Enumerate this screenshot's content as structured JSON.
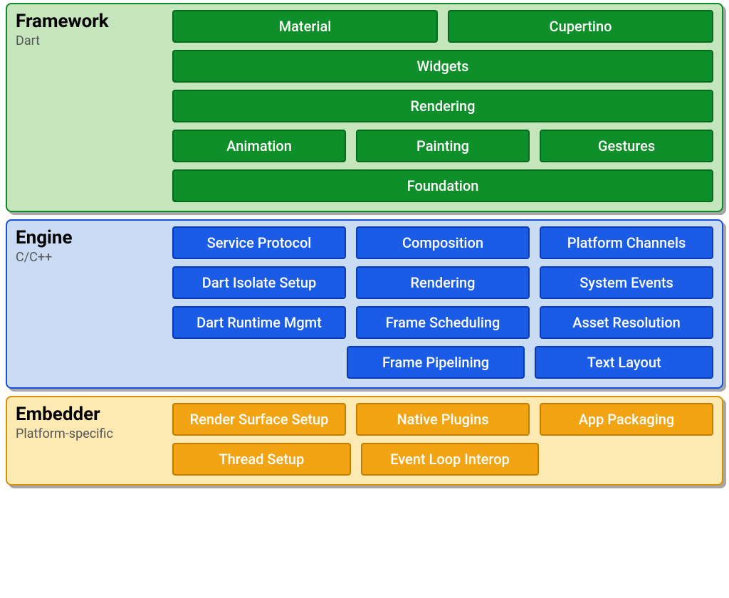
{
  "framework": {
    "title": "Framework",
    "subtitle": "Dart",
    "rows": [
      [
        "Material",
        "Cupertino"
      ],
      [
        "Widgets"
      ],
      [
        "Rendering"
      ],
      [
        "Animation",
        "Painting",
        "Gestures"
      ],
      [
        "Foundation"
      ]
    ]
  },
  "engine": {
    "title": "Engine",
    "subtitle": "C/C++",
    "rows": [
      [
        "Service Protocol",
        "Composition",
        "Platform Channels"
      ],
      [
        "Dart Isolate Setup",
        "Rendering",
        "System Events"
      ],
      [
        "Dart Runtime Mgmt",
        "Frame Scheduling",
        "Asset Resolution"
      ],
      [
        null,
        "Frame Pipelining",
        "Text Layout"
      ]
    ]
  },
  "embedder": {
    "title": "Embedder",
    "subtitle": "Platform-specific",
    "rows": [
      [
        "Render Surface Setup",
        "Native Plugins",
        "App Packaging"
      ],
      [
        "Thread Setup",
        "Event Loop Interop",
        null
      ]
    ]
  }
}
